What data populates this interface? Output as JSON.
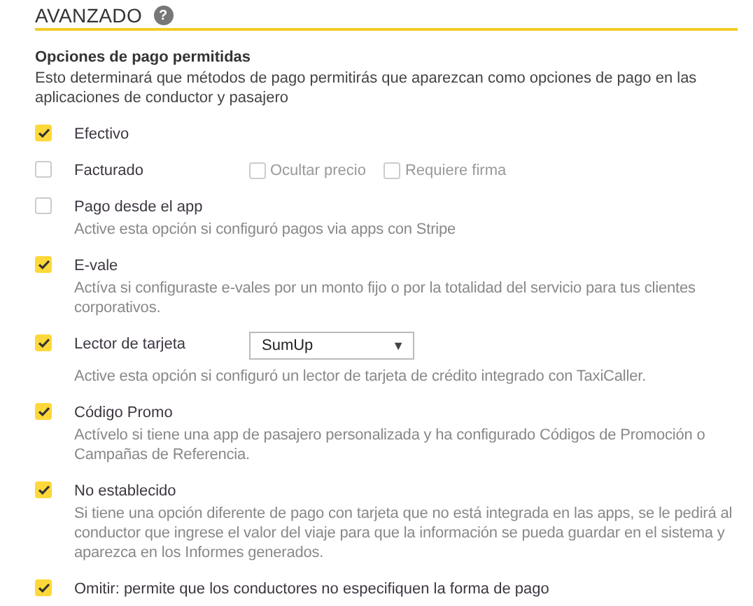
{
  "section": {
    "title": "AVANZADO",
    "help_icon": "?"
  },
  "group": {
    "title": "Opciones de pago permitidas",
    "description": "Esto determinará que métodos de pago permitirás que aparezcan como opciones de pago en las aplicaciones de conductor y pasajero"
  },
  "options": [
    {
      "kind": "plain",
      "label": "Efectivo",
      "checked": true
    },
    {
      "kind": "extras",
      "label": "Facturado",
      "checked": false,
      "extras": [
        {
          "label": "Ocultar precio",
          "checked": false
        },
        {
          "label": "Requiere firma",
          "checked": false
        }
      ]
    },
    {
      "kind": "plain",
      "label": "Pago desde el app",
      "checked": false,
      "description": "Active esta opción si configuró pagos via apps con Stripe"
    },
    {
      "kind": "plain",
      "label": "E-vale",
      "checked": true,
      "description": "Actíva si configuraste e-vales por un monto fijo o por la totalidad del servicio para tus clientes corporativos."
    },
    {
      "kind": "select",
      "label": "Lector de tarjeta",
      "checked": true,
      "select_value": "SumUp",
      "select_arrow": "▼",
      "description": "Active esta opción si configuró un lector de tarjeta de crédito integrado con TaxiCaller."
    },
    {
      "kind": "plain",
      "label": "Código Promo",
      "checked": true,
      "description": "Actívelo si tiene una app de pasajero personalizada y ha configurado Códigos de Promoción o Campañas de Referencia."
    },
    {
      "kind": "plain",
      "label": "No establecido",
      "checked": true,
      "description": "Si tiene una opción diferente de pago con tarjeta que no está integrada en las apps, se le pedirá al conductor que ingrese el valor del viaje para que la información se pueda guardar en el sistema y aparezca en los Informes generados."
    },
    {
      "kind": "plain",
      "label": "Omitir: permite que los conductores no especifiquen la forma de pago",
      "checked": true
    }
  ]
}
